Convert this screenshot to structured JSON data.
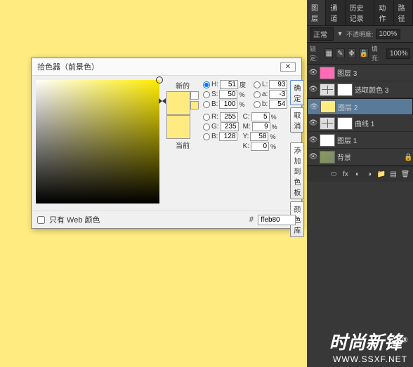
{
  "canvas": {
    "bg": "#ffeb80"
  },
  "picker": {
    "title": "拾色器（前景色）",
    "close": "✕",
    "new_label": "新的",
    "current_label": "当前",
    "btns": {
      "ok": "确定",
      "cancel": "取消",
      "add": "添加到色板",
      "lib": "颜色库"
    },
    "hsb": {
      "h_label": "H:",
      "h": "51",
      "h_unit": "度",
      "s_label": "S:",
      "s": "50",
      "s_unit": "%",
      "b_label": "B:",
      "b": "100",
      "b_unit": "%"
    },
    "rgb": {
      "r_label": "R:",
      "r": "255",
      "g_label": "G:",
      "g": "235",
      "b_label": "B:",
      "b": "128"
    },
    "lab": {
      "l_label": "L:",
      "l": "93",
      "a_label": "a:",
      "a": "-3",
      "b_label": "b:",
      "b": "54"
    },
    "cmyk": {
      "c_label": "C:",
      "c": "5",
      "c_unit": "%",
      "m_label": "M:",
      "m": "9",
      "m_unit": "%",
      "y_label": "Y:",
      "y": "58",
      "y_unit": "%",
      "k_label": "K:",
      "k": "0",
      "k_unit": "%"
    },
    "webonly": "只有 Web 颜色",
    "hex_prefix": "#",
    "hex": "ffeb80"
  },
  "panel": {
    "tabs": [
      "图层",
      "通道",
      "历史记录",
      "动作",
      "路径"
    ],
    "blend": "正常",
    "opacity_label": "不透明度:",
    "opacity": "100%",
    "lock_label": "锁定:",
    "fill_label": "填充:",
    "fill": "100%",
    "layers": [
      {
        "name": "图层 3",
        "thumb": "pink"
      },
      {
        "name": "选取颜色 3",
        "thumb": "adj",
        "mask": true
      },
      {
        "name": "图层 2",
        "thumb": "yellow",
        "selected": true
      },
      {
        "name": "曲线 1",
        "thumb": "adj",
        "mask": true
      },
      {
        "name": "图层 1",
        "thumb": "white"
      },
      {
        "name": "背景",
        "thumb": "bg",
        "locked": true
      }
    ]
  },
  "watermark": {
    "main": "时尚新锋",
    "reg": "®",
    "url": "WWW.SSXF.NET"
  }
}
